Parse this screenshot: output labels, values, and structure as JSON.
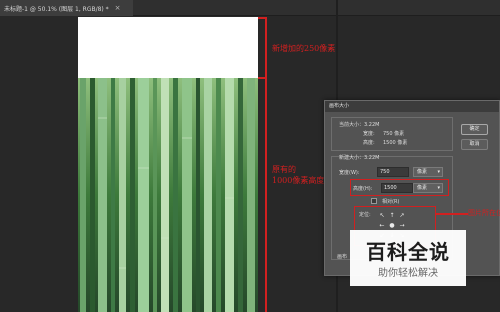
{
  "window": {
    "doc_tab_title": "未标题-1 @ 50.1% (图层 1, RGB/8) *",
    "tab_close_glyph": "×"
  },
  "canvas": {
    "top_fill_color": "#ffffff",
    "photo_colors": [
      "#1f3a20",
      "#3f7a3a",
      "#8fc48a",
      "#c6e3bd"
    ]
  },
  "annotations": {
    "added_note": "新增加的250像素",
    "original_note_line1": "原有的",
    "original_note_line2": "1000像素高度",
    "anchor_note": "图片所在位置",
    "color": "#d12020"
  },
  "dialog": {
    "title": "画布大小",
    "current_size_label": "当前大小：3.22M",
    "current_width_label": "宽度:",
    "current_width_value": "750 像素",
    "current_height_label": "高度:",
    "current_height_value": "1500 像素",
    "new_size_label": "新建大小：3.22M",
    "width_label": "宽度(W):",
    "width_value": "750",
    "width_unit": "像素",
    "height_label": "高度(H):",
    "height_value": "1500",
    "height_unit": "像素",
    "relative_label": "相对(R)",
    "anchor_label": "定位:",
    "canvas_ext_label": "画布",
    "ok_label": "确定",
    "cancel_label": "取消",
    "anchor_arrows": [
      "↖",
      "↑",
      "↗",
      "←",
      "●",
      "→",
      "↙",
      "↓",
      "↘"
    ]
  },
  "watermark": {
    "main": "百科全说",
    "sub": "助你轻松解决"
  }
}
